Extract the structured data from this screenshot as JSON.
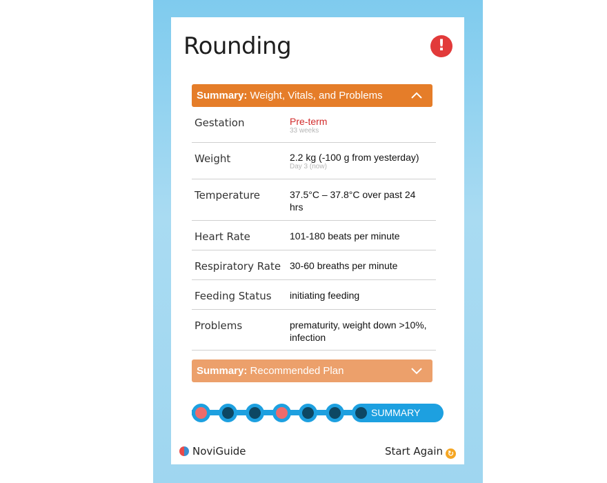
{
  "header": {
    "title": "Rounding",
    "alert_icon": "exclamation-circle-icon"
  },
  "summary1": {
    "bold": "Summary:",
    "label": "Weight, Vitals, and Problems",
    "state": "expanded",
    "color": "#e57d29",
    "rows": [
      {
        "label": "Gestation",
        "value": "Pre-term",
        "sub": "33 weeks",
        "highlight": true
      },
      {
        "label": "Weight",
        "value": "2.2 kg (-100 g from yesterday)",
        "sub": "Day 3 (now)"
      },
      {
        "label": "Temperature",
        "value": "37.5°C – 37.8°C over past 24 hrs"
      },
      {
        "label": "Heart Rate",
        "value": "101-180 beats per minute"
      },
      {
        "label": "Respiratory Rate",
        "value": "30-60 breaths per minute"
      },
      {
        "label": "Feeding Status",
        "value": "initiating feeding"
      },
      {
        "label": "Problems",
        "value": "prematurity, weight down >10%, infection"
      }
    ]
  },
  "summary2": {
    "bold": "Summary:",
    "label": "Recommended Plan",
    "state": "collapsed",
    "color": "#eca06b"
  },
  "progress": {
    "steps": [
      "alert",
      "normal",
      "normal",
      "alert",
      "normal",
      "normal"
    ],
    "current_label": "SUMMARY",
    "colors": {
      "alert": "#ee6b6b",
      "normal": "#0d4763",
      "track": "#1da0e0"
    }
  },
  "footer": {
    "brand": "NoviGuide",
    "brand_icon": "noviguide-logo-icon",
    "start_again": "Start Again",
    "start_again_icon": "refresh-icon"
  }
}
